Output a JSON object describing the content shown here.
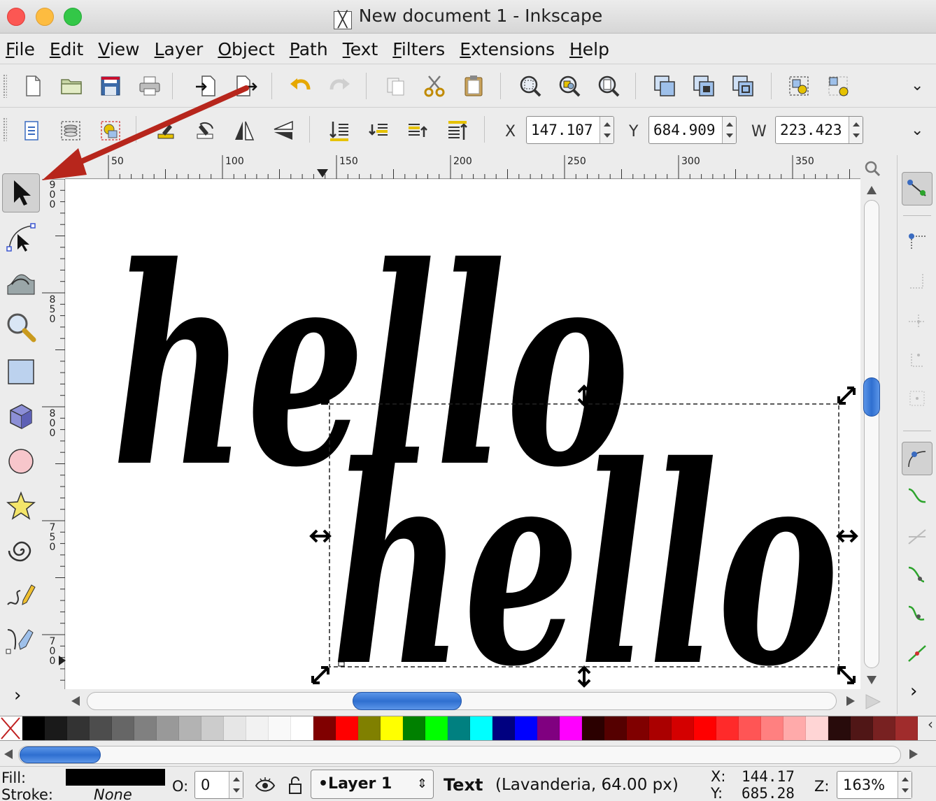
{
  "window": {
    "title": "New document 1 - Inkscape"
  },
  "menu": [
    "File",
    "Edit",
    "View",
    "Layer",
    "Object",
    "Path",
    "Text",
    "Filters",
    "Extensions",
    "Help"
  ],
  "toolbar_main": {
    "icons": [
      "new-document-icon",
      "open-folder-icon",
      "save-icon",
      "print-icon",
      "import-icon",
      "export-icon",
      "undo-icon",
      "redo-icon",
      "copy-icon",
      "cut-icon",
      "paste-icon",
      "zoom-selection-icon",
      "zoom-drawing-icon",
      "zoom-page-icon",
      "duplicate-icon",
      "clone-icon",
      "unlink-clone-icon",
      "group-icon",
      "ungroup-icon"
    ]
  },
  "toolbar_select": {
    "x_label": "X",
    "x_value": "147.107",
    "y_label": "Y",
    "y_value": "684.909",
    "w_label": "W",
    "w_value": "223.423"
  },
  "rulers": {
    "horizontal": [
      "50",
      "100",
      "150",
      "200",
      "250",
      "300",
      "350"
    ],
    "vertical": [
      "900",
      "850",
      "800",
      "750",
      "700"
    ]
  },
  "canvas": {
    "text_top": "hello",
    "text_bottom": "hello"
  },
  "status": {
    "fill_label": "Fill:",
    "stroke_label": "Stroke:",
    "stroke_value": "None",
    "opacity_label": "O:",
    "opacity_value": "0",
    "layer": "•Layer 1",
    "object_type": "Text",
    "object_detail": "(Lavanderia, 64.00 px)",
    "cursor_x_label": "X:",
    "cursor_x": "144.17",
    "cursor_y_label": "Y:",
    "cursor_y": "685.28",
    "zoom_label": "Z:",
    "zoom_value": "163%"
  },
  "palette": [
    "#000000",
    "#1a1a1a",
    "#333333",
    "#4d4d4d",
    "#666666",
    "#808080",
    "#999999",
    "#b3b3b3",
    "#cccccc",
    "#e6e6e6",
    "#f2f2f2",
    "#f9f9f9",
    "#ffffff",
    "#800000",
    "#ff0000",
    "#808000",
    "#ffff00",
    "#008000",
    "#00ff00",
    "#008080",
    "#00ffff",
    "#000080",
    "#0000ff",
    "#800080",
    "#ff00ff",
    "#2b0000",
    "#550000",
    "#800000",
    "#aa0000",
    "#d40000",
    "#ff0000",
    "#ff2a2a",
    "#ff5555",
    "#ff8080",
    "#ffaaaa",
    "#ffd5d5",
    "#280b0b",
    "#501616",
    "#782121",
    "#a02c2c"
  ]
}
